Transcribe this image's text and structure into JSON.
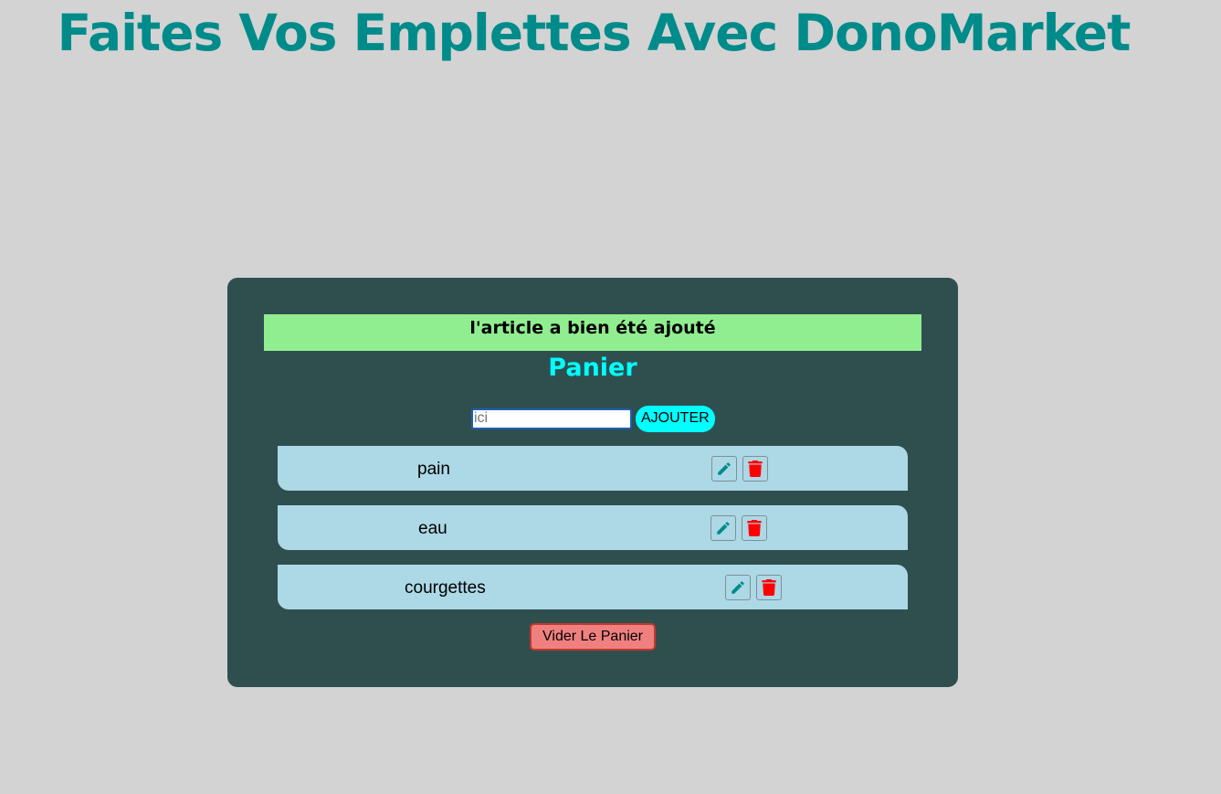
{
  "header": {
    "title": "Faites Vos Emplettes Avec DonoMarket"
  },
  "cart": {
    "alert_message": "l'article a bien été ajouté",
    "title": "Panier",
    "input_placeholder": "ici",
    "input_value": "",
    "add_button_label": "AJOUTER",
    "items": [
      {
        "label": "pain"
      },
      {
        "label": "eau"
      },
      {
        "label": "courgettes"
      }
    ],
    "empty_button_label": "Vider Le Panier"
  },
  "colors": {
    "background": "#d3d3d3",
    "title": "#008b8b",
    "panel": "#2f4f4f",
    "alert": "#90ee90",
    "cart_title": "#00ffff",
    "item_background": "#add8e6",
    "edit_icon": "#008b8b",
    "delete_icon": "#ff0000",
    "empty_button": "#f08080"
  },
  "icons": {
    "edit": "pencil-icon",
    "delete": "trash-icon"
  }
}
